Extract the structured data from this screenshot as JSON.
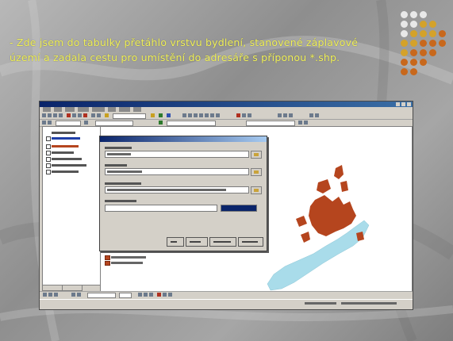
{
  "slide": {
    "title": "- Zde jsem do tabulky přetáhlo vrstvu bydlení, stanovené záplavové území a zadala cestu pro umístění do adresáře s příponou *.shp."
  },
  "colors": {
    "title_text": "#f2f25a",
    "dot_white": "#e8e8e8",
    "dot_gold": "#d4a22a",
    "dot_orange": "#c8681c",
    "water": "#a9dcea",
    "buildings": "#b5451e",
    "titlebar": "#0a246a"
  },
  "icons": {
    "decor": "dot-grid-icon",
    "layer_symbol": "polygon-fill-icon",
    "browse": "folder-icon"
  }
}
